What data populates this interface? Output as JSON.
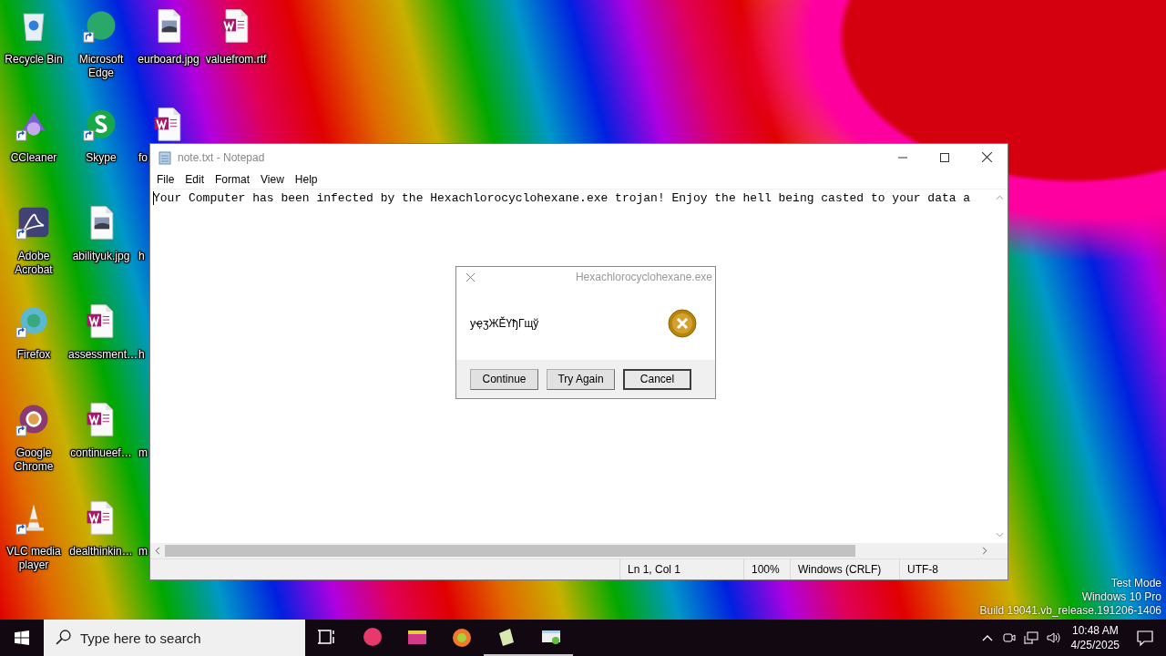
{
  "desktop": {
    "icons": [
      {
        "label": "Recycle Bin",
        "kind": "recycle",
        "shortcut": false,
        "label_cut": false
      },
      {
        "label": "CCleaner",
        "kind": "ccleaner",
        "shortcut": true,
        "label_cut": false
      },
      {
        "label": "Adobe Acrobat",
        "kind": "acrobat",
        "shortcut": true,
        "label_cut": false
      },
      {
        "label": "Firefox",
        "kind": "firefox",
        "shortcut": true,
        "label_cut": false
      },
      {
        "label": "Google Chrome",
        "kind": "chrome",
        "shortcut": true,
        "label_cut": false
      },
      {
        "label": "VLC media player",
        "kind": "vlc",
        "shortcut": true,
        "label_cut": false
      },
      {
        "label": "Microsoft Edge",
        "kind": "edge",
        "shortcut": true,
        "label_cut": false
      },
      {
        "label": "Skype",
        "kind": "skype",
        "shortcut": true,
        "label_cut": false
      },
      {
        "label": "abilityuk.jpg",
        "kind": "image",
        "shortcut": false,
        "label_cut": false
      },
      {
        "label": "assessment…",
        "kind": "word",
        "shortcut": false,
        "label_cut": false
      },
      {
        "label": "continueef…",
        "kind": "word",
        "shortcut": false,
        "label_cut": false
      },
      {
        "label": "dealthinkin…",
        "kind": "word",
        "shortcut": false,
        "label_cut": false
      },
      {
        "label": "eurboard.jpg",
        "kind": "image",
        "shortcut": false,
        "label_cut": false
      },
      {
        "label": "fo",
        "kind": "word",
        "shortcut": false,
        "label_cut": true
      },
      {
        "label": "h",
        "kind": "hidden",
        "label_cut": true
      },
      {
        "label": "h",
        "kind": "hidden",
        "label_cut": true
      },
      {
        "label": "m",
        "kind": "hidden",
        "label_cut": true
      },
      {
        "label": "m",
        "kind": "hidden",
        "label_cut": true
      },
      {
        "label": "valuefrom.rtf",
        "kind": "word",
        "shortcut": false,
        "label_cut": false
      }
    ],
    "system_info": [
      "Test Mode",
      "Windows 10 Pro",
      "Build 19041.vb_release.191206-1406"
    ]
  },
  "notepad": {
    "title": "note.txt - Notepad",
    "menu": [
      "File",
      "Edit",
      "Format",
      "View",
      "Help"
    ],
    "text": "Your Computer has been infected by the Hexachlorocyclohexane.exe trojan! Enjoy the hell being casted to your data a",
    "status": [
      "Ln 1, Col 1",
      "100%",
      "Windows (CRLF)",
      "UTF-8"
    ]
  },
  "dialog": {
    "title": "Hexachlorocyclohexane.exe",
    "message": "уҿӡЖĚҮђГщў",
    "buttons": [
      {
        "label": "Continue",
        "default": false
      },
      {
        "label": "Try Again",
        "default": false
      },
      {
        "label": "Cancel",
        "default": true
      }
    ]
  },
  "taskbar": {
    "search_placeholder": "Type here to search",
    "apps": [
      {
        "kind": "taskview",
        "running": false
      },
      {
        "kind": "edge",
        "running": false
      },
      {
        "kind": "folder",
        "running": false
      },
      {
        "kind": "firefox",
        "running": false
      },
      {
        "kind": "notepad",
        "running": true
      },
      {
        "kind": "window",
        "running": true
      }
    ],
    "time": "10:48 AM",
    "date": "4/25/2025"
  }
}
